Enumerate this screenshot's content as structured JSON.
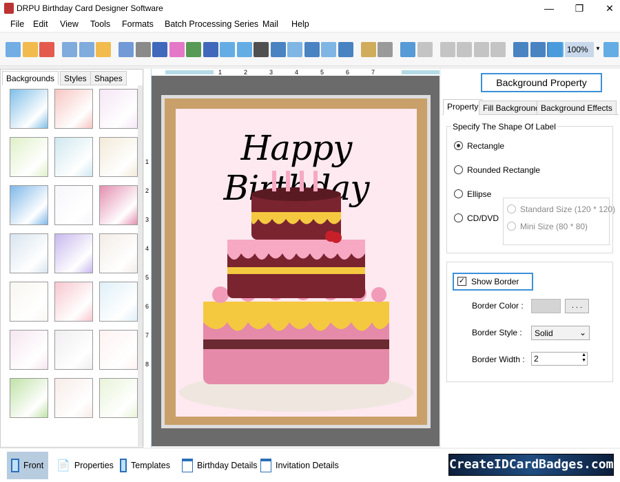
{
  "window": {
    "title": "DRPU Birthday Card Designer Software",
    "min": "—",
    "max": "❐",
    "close": "✕"
  },
  "menu": [
    "File",
    "Edit",
    "View",
    "Tools",
    "Formats",
    "Batch Processing Series",
    "Mail",
    "Help"
  ],
  "toolbar": {
    "zoom_value": "100%",
    "icons": [
      "new",
      "open",
      "close",
      "save",
      "save-as",
      "export",
      "page-setup",
      "print",
      "layers",
      "gift",
      "image",
      "pen",
      "shapes",
      "watermark",
      "barcode",
      "text",
      "text-doc",
      "signature",
      "mail",
      "line",
      "database-import",
      "database",
      "undo",
      "redo",
      "cut",
      "copy",
      "paste",
      "delete",
      "grid",
      "actual-size",
      "fit",
      "zoom-in",
      "zoom-out"
    ]
  },
  "left_panel": {
    "tabs": [
      "Backgrounds",
      "Styles",
      "Shapes"
    ],
    "active_tab": "Backgrounds",
    "thumbnails": [
      [
        "#7fbfe8",
        "#f7c6c2",
        "#f5e6f5"
      ],
      [
        "#dff0c8",
        "#cfe8f0",
        "#f3ead8"
      ],
      [
        "#7fb8e8",
        "#f7f7fb",
        "#e48fb0"
      ],
      [
        "#d8e4ef",
        "#c8b8ee",
        "#f3ece6"
      ],
      [
        "#f8f6f0",
        "#f7c7cf",
        "#dff0f8"
      ],
      [
        "#f6e6f0",
        "#f0eef0",
        "#fff2f2"
      ],
      [
        "#bfe2a6",
        "#f7ece8",
        "#e8f4d8"
      ]
    ]
  },
  "rulers": {
    "h_ticks": [
      "1",
      "2",
      "3",
      "4",
      "5",
      "6",
      "7"
    ],
    "v_ticks": [
      "1",
      "2",
      "3",
      "4",
      "5",
      "6",
      "7",
      "8"
    ]
  },
  "card": {
    "headline": "Happy Birthday",
    "border_color": "#c9a06a",
    "background": "#fde9ef"
  },
  "right_panel": {
    "header_button": "Background Property",
    "tabs": [
      "Property",
      "Fill Background",
      "Background Effects"
    ],
    "active_tab": "Property",
    "shape_group": {
      "legend": "Specify The Shape Of Label",
      "options": [
        "Rectangle",
        "Rounded Rectangle",
        "Ellipse",
        "CD/DVD"
      ],
      "selected": "Rectangle",
      "cd_options": [
        "Standard Size (120 * 120)",
        "Mini Size (80 * 80)"
      ]
    },
    "border": {
      "show_border_label": "Show Border",
      "show_border": true,
      "color_label": "Border Color :",
      "color_value": "#d4d4d4",
      "color_button": ". . .",
      "style_label": "Border Style :",
      "style_value": "Solid",
      "width_label": "Border Width :",
      "width_value": "2"
    }
  },
  "bottom": {
    "tabs": [
      "Front",
      "Properties",
      "Templates",
      "Birthday Details",
      "Invitation Details"
    ],
    "active": "Front",
    "brand": "CreateIDCardBadges.com"
  }
}
